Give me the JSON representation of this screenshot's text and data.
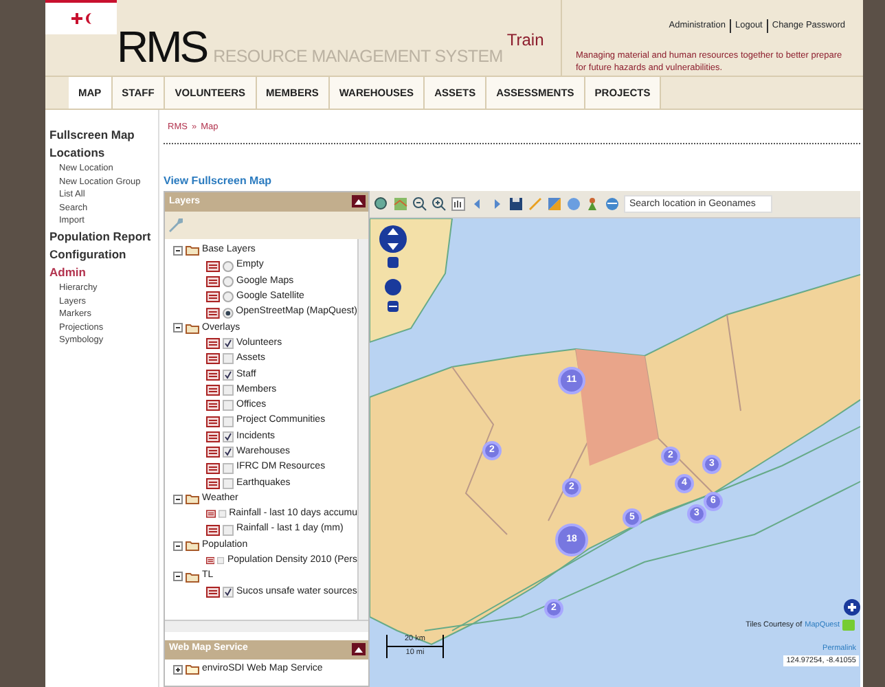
{
  "header": {
    "title_short": "RMS",
    "title_long": "RESOURCE MANAGEMENT SYSTEM",
    "instance": "Train",
    "top_links": [
      "Administration",
      "Logout",
      "Change Password"
    ],
    "tagline": "Managing material and human resources together to better prepare for future hazards and vulnerabilities."
  },
  "nav": [
    {
      "label": "MAP",
      "selected": true
    },
    {
      "label": "STAFF",
      "selected": false
    },
    {
      "label": "VOLUNTEERS",
      "selected": false
    },
    {
      "label": "MEMBERS",
      "selected": false
    },
    {
      "label": "WAREHOUSES",
      "selected": false
    },
    {
      "label": "ASSETS",
      "selected": false
    },
    {
      "label": "ASSESSMENTS",
      "selected": false
    },
    {
      "label": "PROJECTS",
      "selected": false
    }
  ],
  "sidebar": [
    {
      "label": "Fullscreen Map",
      "selected": false
    },
    {
      "label": "Locations",
      "selected": false,
      "items": [
        "New Location",
        "New Location Group",
        "List All",
        "Search",
        "Import"
      ]
    },
    {
      "label": "Population Report",
      "selected": false
    },
    {
      "label": "Configuration",
      "selected": false
    },
    {
      "label": "Admin",
      "selected": true,
      "items": [
        "Hierarchy",
        "Layers",
        "Markers",
        "Projections",
        "Symbology"
      ]
    }
  ],
  "breadcrumb": {
    "items": [
      "RMS",
      "Map"
    ],
    "separator": "»"
  },
  "fullscreen_link": "View Fullscreen Map",
  "layers_panel": {
    "title": "Layers",
    "tree": [
      {
        "label": "Base Layers",
        "expanded": true,
        "children": [
          {
            "label": "Empty",
            "kind": "radio",
            "selected": false
          },
          {
            "label": "Google Maps",
            "kind": "radio",
            "selected": false
          },
          {
            "label": "Google Satellite",
            "kind": "radio",
            "selected": false
          },
          {
            "label": "OpenStreetMap (MapQuest)",
            "kind": "radio",
            "selected": true
          }
        ]
      },
      {
        "label": "Overlays",
        "expanded": true,
        "children": [
          {
            "label": "Volunteers",
            "kind": "check",
            "checked": true
          },
          {
            "label": "Assets",
            "kind": "check",
            "checked": false
          },
          {
            "label": "Staff",
            "kind": "check",
            "checked": true
          },
          {
            "label": "Members",
            "kind": "check",
            "checked": false
          },
          {
            "label": "Offices",
            "kind": "check",
            "checked": false
          },
          {
            "label": "Project Communities",
            "kind": "check",
            "checked": false
          },
          {
            "label": "Incidents",
            "kind": "check",
            "checked": true
          },
          {
            "label": "Warehouses",
            "kind": "check",
            "checked": true
          },
          {
            "label": "IFRC DM Resources",
            "kind": "check",
            "checked": false
          },
          {
            "label": "Earthquakes",
            "kind": "check",
            "checked": false
          }
        ]
      },
      {
        "label": "Weather",
        "expanded": true,
        "children": [
          {
            "label": "Rainfall - last 10 days accumu",
            "kind": "check",
            "checked": false
          },
          {
            "label": "Rainfall - last 1 day (mm)",
            "kind": "check",
            "checked": false
          }
        ]
      },
      {
        "label": "Population",
        "expanded": true,
        "children": [
          {
            "label": "Population Density 2010 (Pers",
            "kind": "check",
            "checked": false
          }
        ]
      },
      {
        "label": "TL",
        "expanded": true,
        "children": [
          {
            "label": "Sucos unsafe water sources",
            "kind": "check",
            "checked": true
          }
        ]
      }
    ]
  },
  "wms_panel": {
    "title": "Web Map Service",
    "tree": [
      {
        "label": "enviroSDI Web Map Service",
        "expanded": false
      }
    ]
  },
  "map": {
    "search_placeholder": "Search location in Geonames",
    "clusters": [
      "11",
      "2",
      "2",
      "2",
      "4",
      "3",
      "5",
      "6",
      "3",
      "18",
      "2"
    ],
    "scale": [
      "20 km",
      "10 mi"
    ],
    "attribution_prefix": "Tiles Courtesy of",
    "attribution_link": "MapQuest",
    "permalink": "Permalink",
    "coordinates": "124.97254, -8.41055"
  }
}
